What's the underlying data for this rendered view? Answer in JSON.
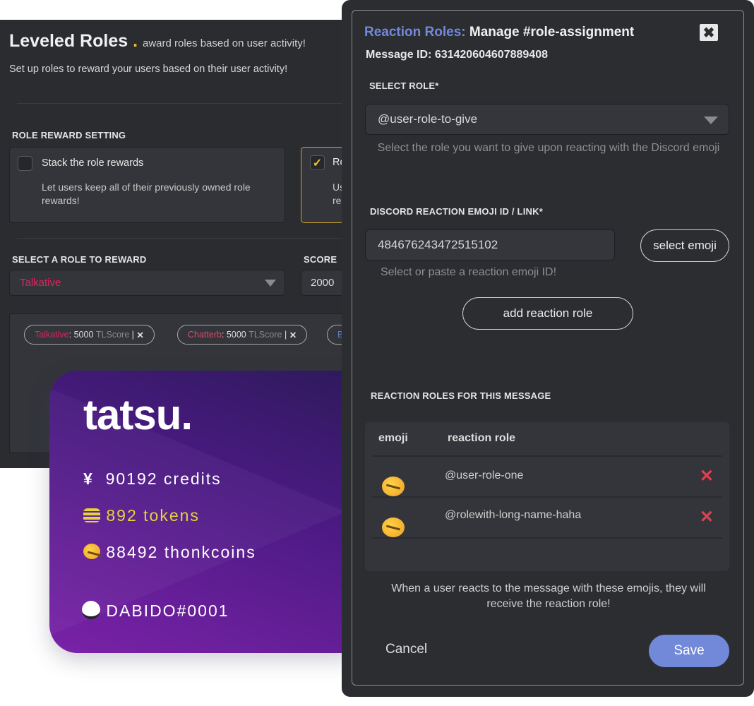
{
  "leveled_roles": {
    "title": "Leveled Roles",
    "dot": ".",
    "subtitle": "award roles based on user activity!",
    "description": "Set up roles to reward your users based on their user activity!",
    "role_reward_setting_label": "ROLE REWARD SETTING",
    "options": [
      {
        "title": "Stack the role rewards",
        "description": "Let users keep all of their previously owned role rewards!",
        "checked": false
      },
      {
        "title": "Re",
        "description": "Us re",
        "checked": true
      }
    ],
    "select_role_label": "SELECT A ROLE TO REWARD",
    "selected_role": "Talkative",
    "score_label": "SCORE",
    "score_value": "2000",
    "chips": [
      {
        "role": "Talkative",
        "sep": ":",
        "score": "5000",
        "unit": "TLScore",
        "bar": "|"
      },
      {
        "role": "Chatterb",
        "sep": ":",
        "score": "5000",
        "unit": "TLScore",
        "bar": "|"
      },
      {
        "role": "B"
      }
    ],
    "accent_color": "#f2c12e",
    "role_color": "#e0245e"
  },
  "card": {
    "logo": "tatsu.",
    "credits_icon": "¥",
    "credits": "90192 credits",
    "tokens": "892 tokens",
    "thonkcoins": "88492 thonkcoins",
    "username": "DABIDO#0001",
    "tokens_color": "#e8d23a"
  },
  "modal": {
    "title_accent": "Reaction Roles:",
    "title": "Manage #role-assignment",
    "close_label": "✖",
    "message_id": "Message ID: 631420604607889408",
    "select_role_label": "SELECT ROLE*",
    "select_role_value": "@user-role-to-give",
    "select_role_help": "Select the role you want to give upon reacting with the Discord emoji",
    "emoji_label": "DISCORD REACTION EMOJI ID / LINK*",
    "emoji_value": "484676243472515102",
    "select_emoji_button": "select emoji",
    "emoji_help": "Select or paste a reaction emoji ID!",
    "add_button": "add reaction role",
    "list_label": "REACTION ROLES FOR THIS MESSAGE",
    "columns": [
      "emoji",
      "reaction role"
    ],
    "rows": [
      {
        "emoji": "thonk-emoji",
        "role": "@user-role-one"
      },
      {
        "emoji": "thonk-emoji",
        "role": "@rolewith-long-name-haha"
      }
    ],
    "footer_note": "When a user reacts to the message with these emojis, they will receive the reaction role!",
    "cancel": "Cancel",
    "save": "Save",
    "accent_color": "#7289da",
    "delete_color": "#e0404f"
  }
}
